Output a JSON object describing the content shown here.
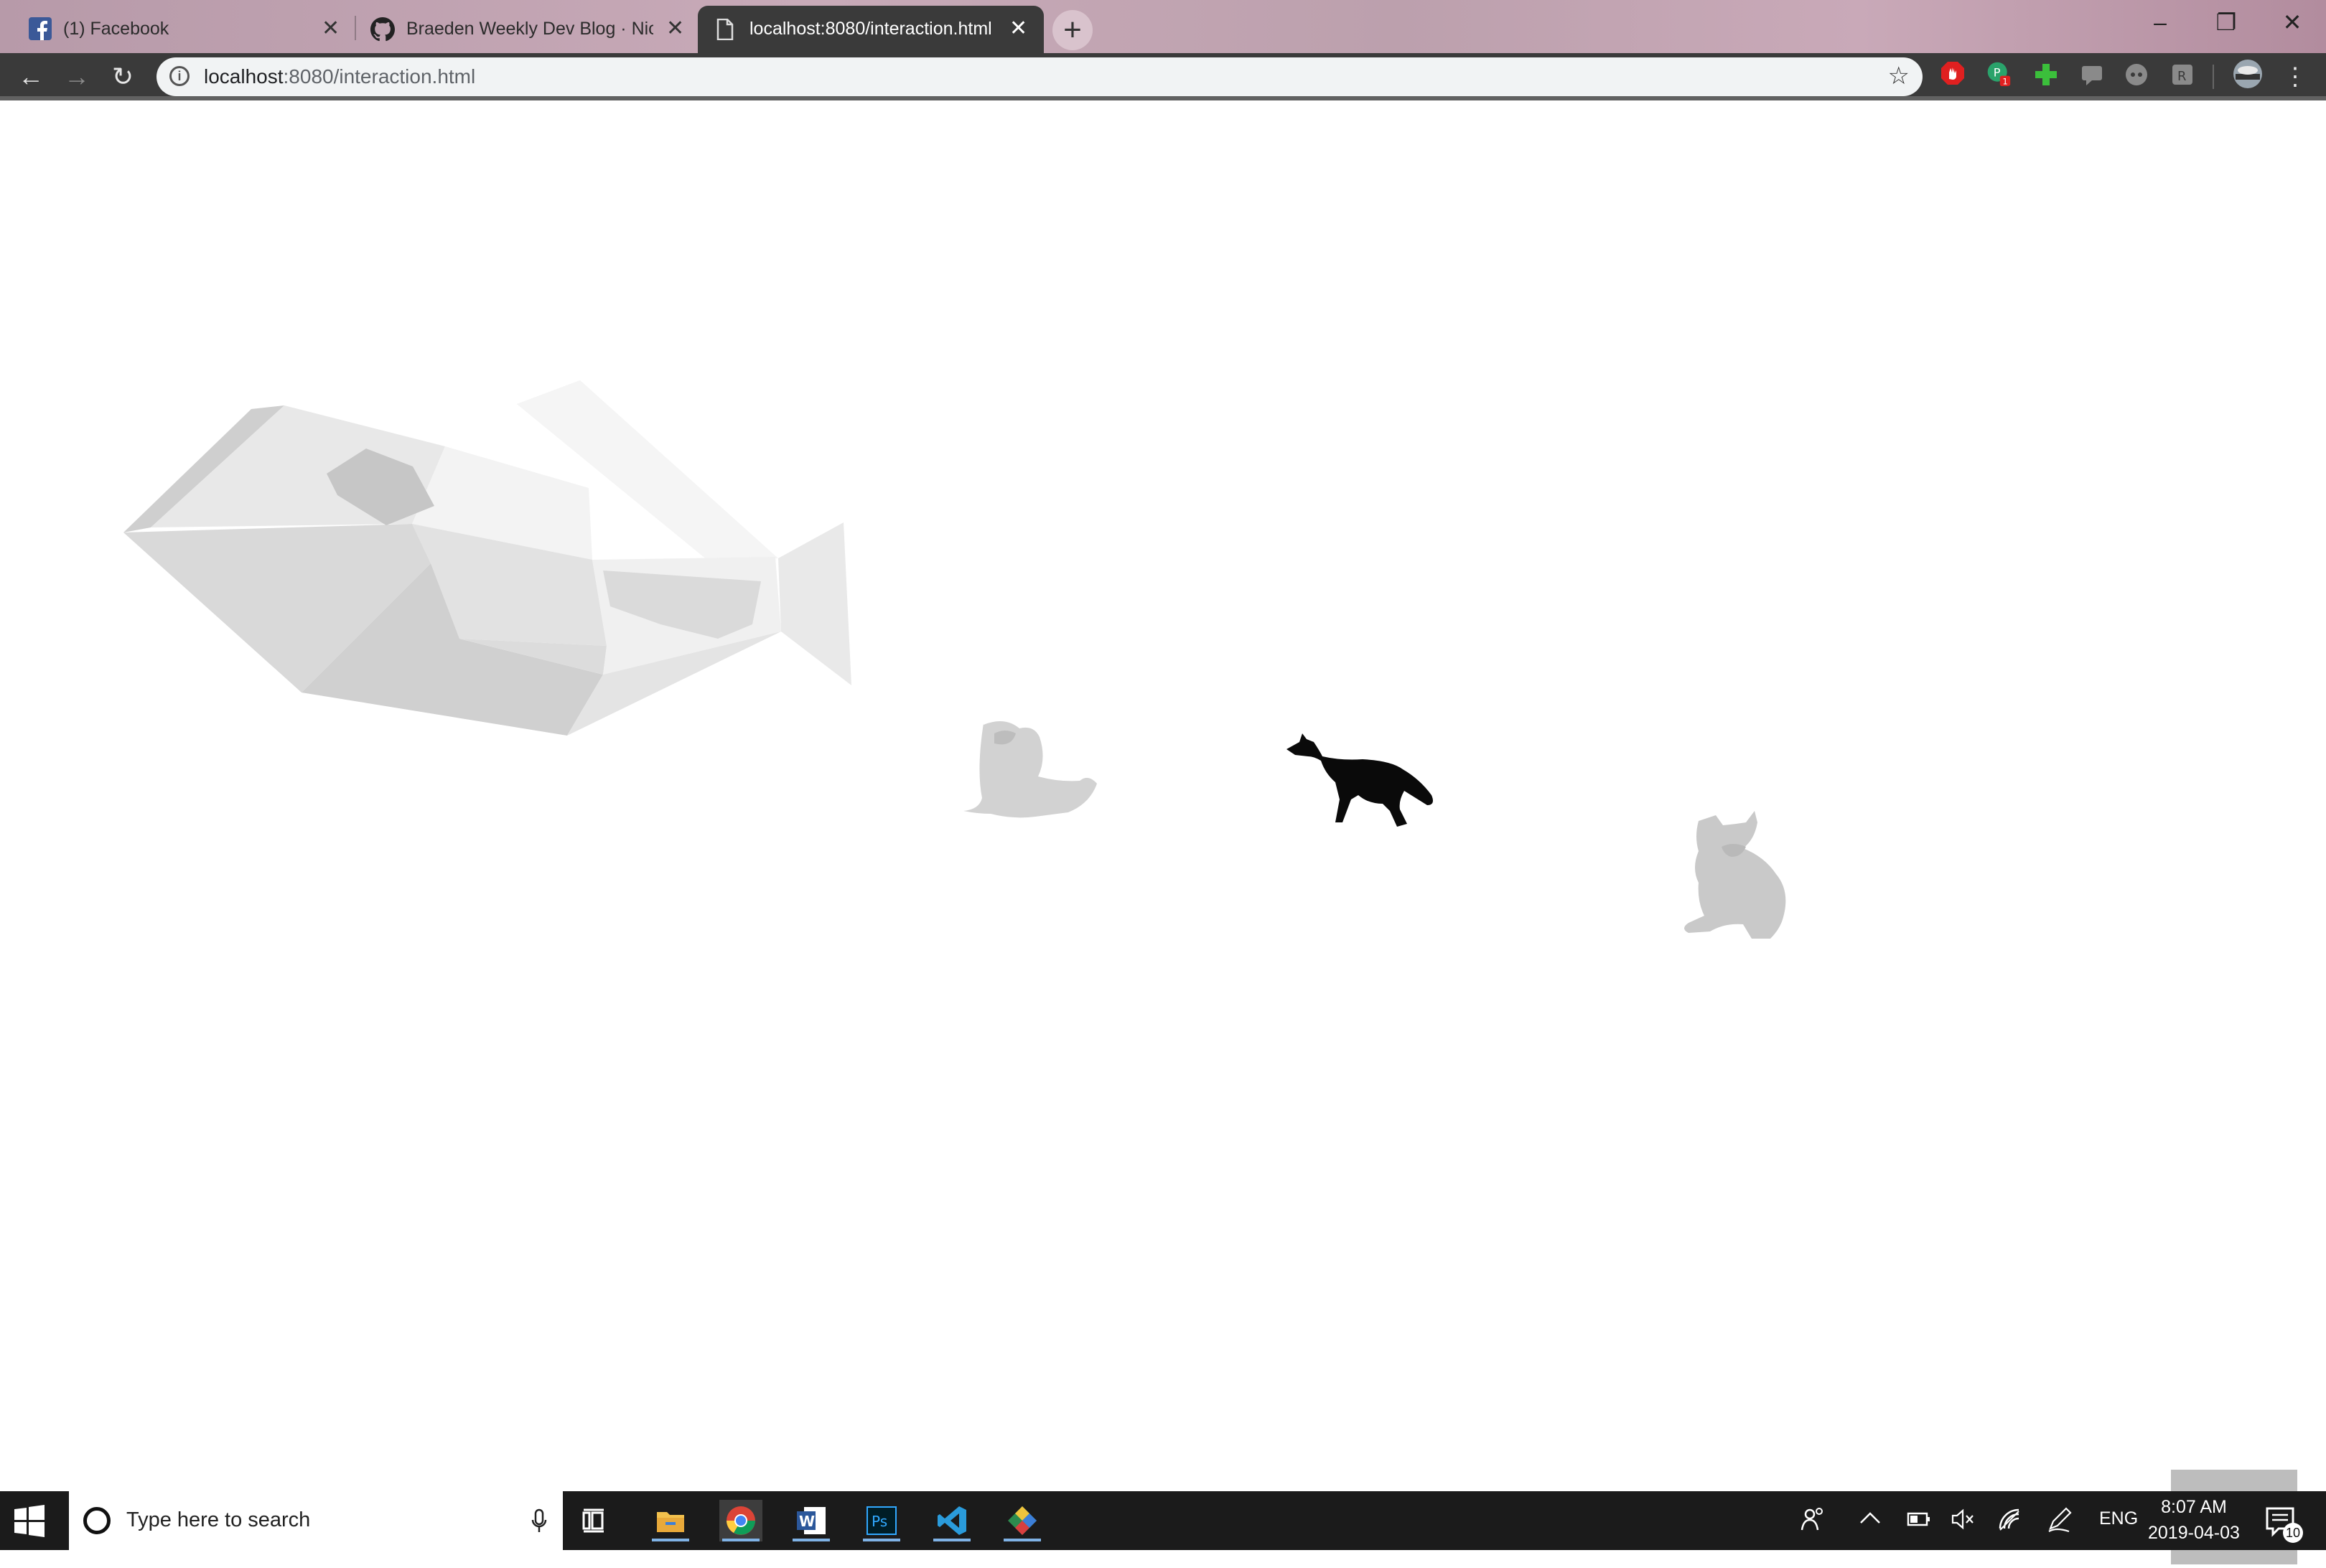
{
  "browser": {
    "tabs": [
      {
        "title": "(1) Facebook",
        "icon": "facebook-icon",
        "active": false
      },
      {
        "title": "Braeden Weekly Dev Blog · Nicol",
        "icon": "github-icon",
        "active": false
      },
      {
        "title": "localhost:8080/interaction.html",
        "icon": "page-icon",
        "active": true
      }
    ],
    "new_tab_label": "+",
    "window_controls": {
      "minimize": "–",
      "restore": "❐",
      "close": "✕"
    },
    "nav": {
      "back": "←",
      "forward": "→",
      "reload": "↻"
    },
    "address": {
      "host": "localhost",
      "rest": ":8080/interaction.html"
    },
    "bookmark_star": "☆",
    "extensions": [
      "adblock-icon",
      "grammarly-icon",
      "plus-extension-icon",
      "chat-extension-icon",
      "discord-icon",
      "reader-icon"
    ],
    "menu": "⋮"
  },
  "scene": {
    "models": [
      "low-poly-fish-model",
      "sitting-animal-model",
      "black-wolf-model",
      "sitting-corgi-model"
    ],
    "colors": {
      "fish": "#e6e6e6",
      "frog": "#d4d4d4",
      "wolf": "#0a0a0a",
      "corgi": "#cccccc"
    },
    "vr_button_icon": "vr-headset-icon"
  },
  "taskbar": {
    "search_placeholder": "Type here to search",
    "apps": [
      "task-view-icon",
      "file-explorer-icon",
      "chrome-icon",
      "word-icon",
      "photoshop-icon",
      "vscode-icon",
      "git-icon"
    ],
    "language": "ENG",
    "time": "8:07 AM",
    "date": "2019-04-03",
    "notification_count": "10"
  }
}
